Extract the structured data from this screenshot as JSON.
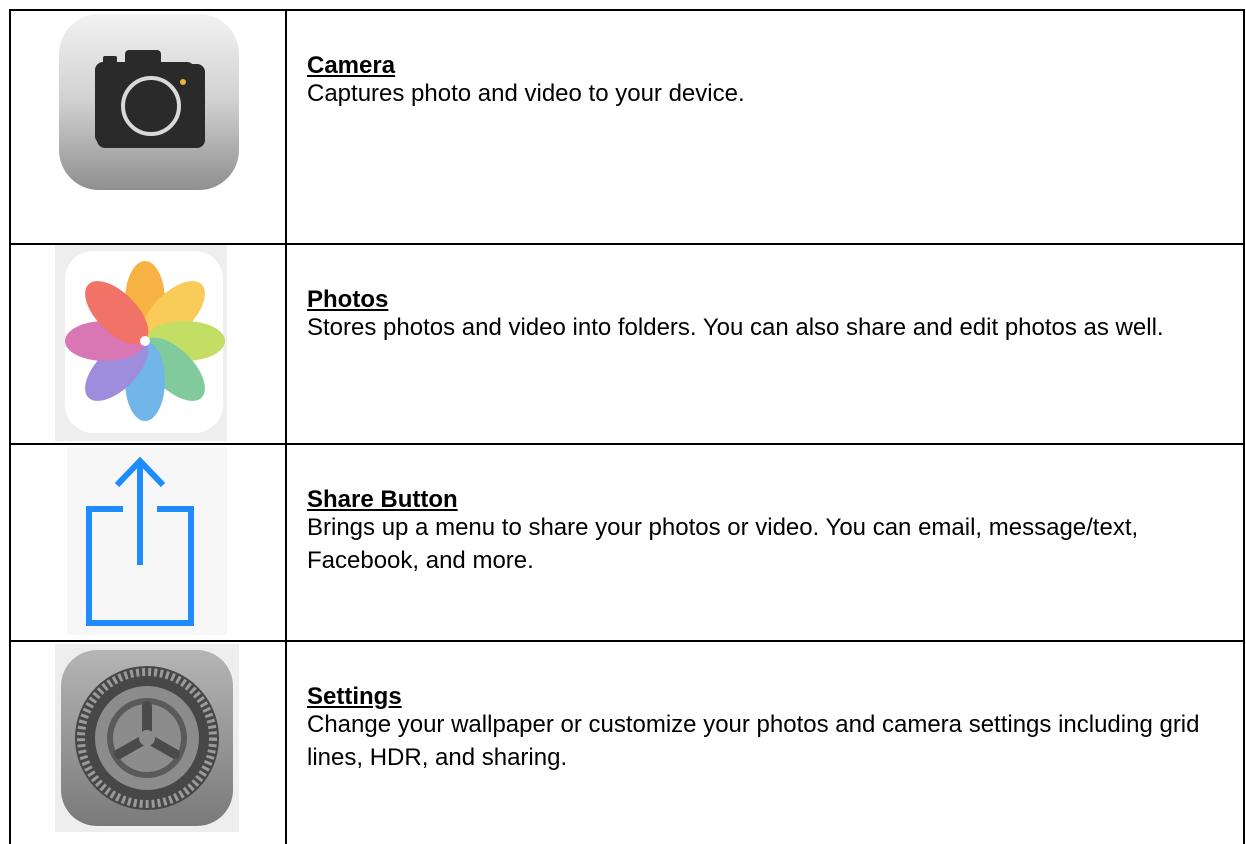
{
  "rows": [
    {
      "icon": "camera-icon",
      "title": "Camera",
      "description": "Captures photo and video to your device."
    },
    {
      "icon": "photos-icon",
      "title": "Photos",
      "description": "Stores photos and video into folders. You can also share and edit photos as well."
    },
    {
      "icon": "share-icon",
      "title": "Share Button",
      "description": "Brings up a menu to share your photos or video. You can email, message/text, Facebook, and more."
    },
    {
      "icon": "settings-icon",
      "title": "Settings",
      "description": "Change your wallpaper or customize your photos and camera settings including grid lines, HDR, and sharing."
    }
  ],
  "colors": {
    "share_blue": "#1e8cff",
    "border": "#000000"
  }
}
